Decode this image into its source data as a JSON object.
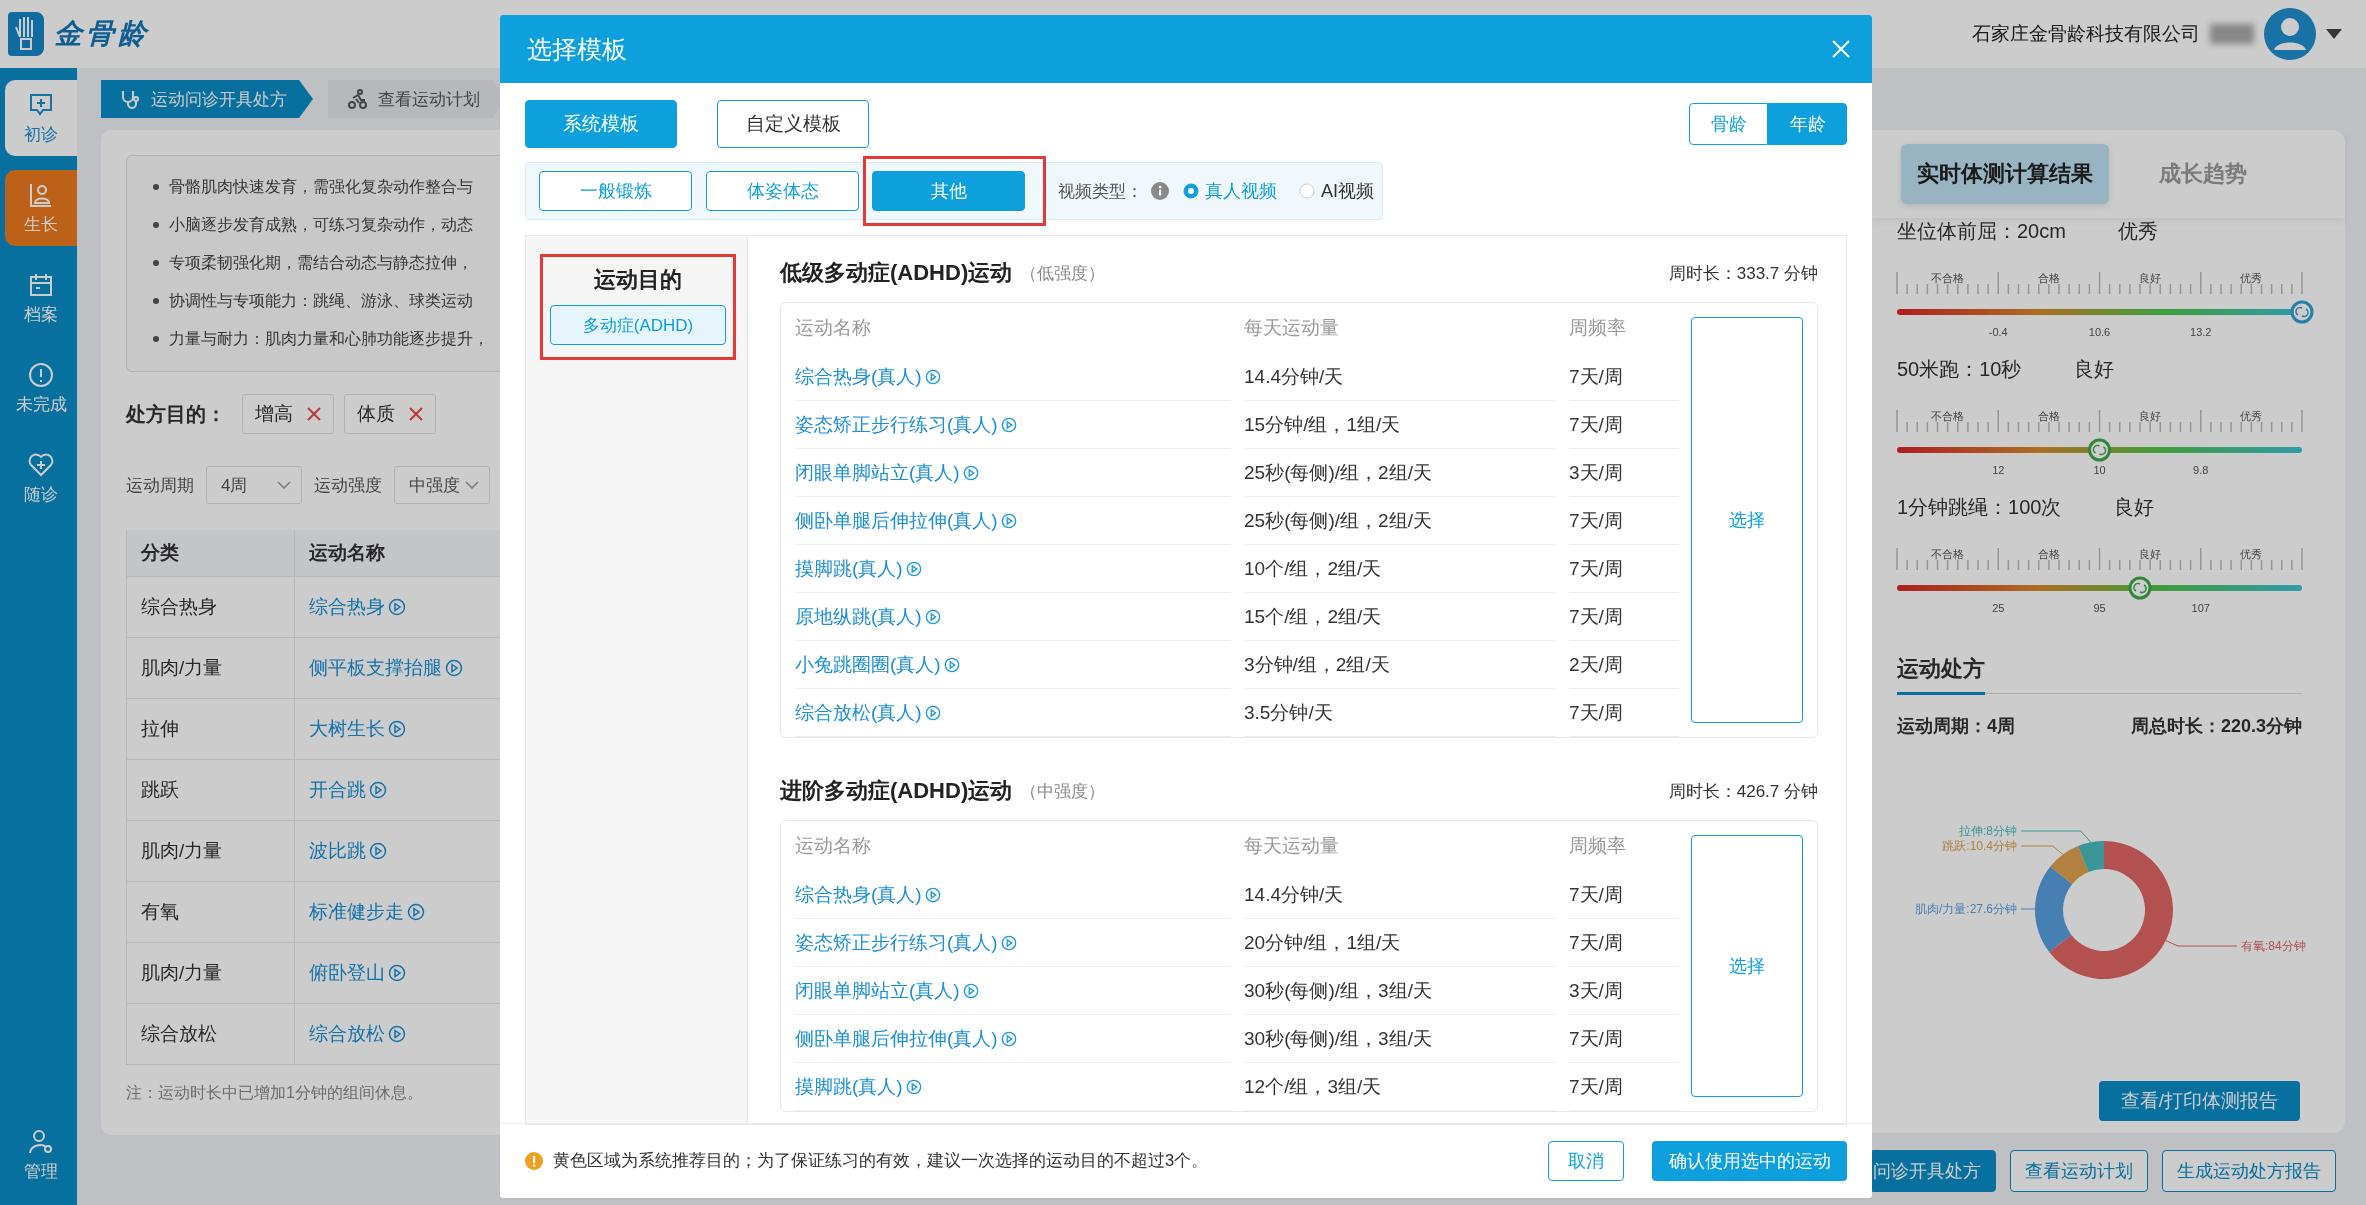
{
  "header": {
    "logo_text": "金骨龄",
    "company": "石家庄金骨龄科技有限公司"
  },
  "sidebar": {
    "items": [
      {
        "label": "初诊",
        "kind": "consult",
        "selected": false,
        "highlighted": true
      },
      {
        "label": "生长",
        "kind": "growth",
        "selected": true,
        "highlighted": false
      },
      {
        "label": "档案",
        "kind": "archive",
        "selected": false,
        "highlighted": false
      },
      {
        "label": "未完成",
        "kind": "pending",
        "selected": false,
        "highlighted": false
      },
      {
        "label": "随诊",
        "kind": "followup",
        "selected": false,
        "highlighted": false
      },
      {
        "label": "管理",
        "kind": "admin",
        "selected": false,
        "highlighted": false
      }
    ]
  },
  "steps": [
    {
      "label": "运动问诊开具处方",
      "kind": "consult",
      "selected": true
    },
    {
      "label": "查看运动计划",
      "kind": "plan",
      "selected": false
    }
  ],
  "notes": [
    "骨骼肌肉快速发育，需强化复杂动作整合与",
    "小脑逐步发育成熟，可练习复杂动作，动态",
    "专项柔韧强化期，需结合动态与静态拉伸，",
    "协调性与专项能力：跳绳、游泳、球类运动",
    "力量与耐力：肌肉力量和心肺功能逐步提升，"
  ],
  "purpose": {
    "label": "处方目的：",
    "tags": [
      "增高",
      "体质"
    ]
  },
  "filters": [
    {
      "label": "运动周期",
      "value": "4周"
    },
    {
      "label": "运动强度",
      "value": "中强度"
    }
  ],
  "table": {
    "columns": [
      "分类",
      "运动名称"
    ],
    "rows": [
      [
        "综合热身",
        "综合热身"
      ],
      [
        "肌肉/力量",
        "侧平板支撑抬腿"
      ],
      [
        "拉伸",
        "大树生长"
      ],
      [
        "跳跃",
        "开合跳"
      ],
      [
        "肌肉/力量",
        "波比跳"
      ],
      [
        "有氧",
        "标准健步走"
      ],
      [
        "肌肉/力量",
        "俯卧登山"
      ],
      [
        "综合放松",
        "综合放松"
      ]
    ]
  },
  "footnote": "注：运动时长中已增加1分钟的组间休息。",
  "dialog": {
    "title": "选择模板",
    "source_tabs": [
      {
        "label": "系统模板",
        "selected": true
      },
      {
        "label": "自定义模板",
        "selected": false
      }
    ],
    "basis_toggle": [
      {
        "label": "骨龄",
        "selected": false
      },
      {
        "label": "年龄",
        "selected": true
      }
    ],
    "categories": [
      {
        "label": "一般锻炼",
        "selected": false,
        "highlighted": false
      },
      {
        "label": "体姿体态",
        "selected": false,
        "highlighted": false
      },
      {
        "label": "其他",
        "selected": true,
        "highlighted": true
      }
    ],
    "video_type": {
      "label": "视频类型：",
      "options": [
        {
          "label": "真人视频",
          "selected": true
        },
        {
          "label": "AI视频",
          "selected": false
        }
      ]
    },
    "purpose": {
      "title": "运动目的",
      "highlighted": true,
      "items": [
        {
          "label": "多动症(ADHD)",
          "selected": true
        }
      ]
    },
    "templates": [
      {
        "title": "低级多动症(ADHD)运动",
        "intensity": "（低强度）",
        "duration": "周时长：333.7 分钟",
        "select_label": "选择",
        "columns": [
          "运动名称",
          "每天运动量",
          "周频率"
        ],
        "rows": [
          [
            "综合热身(真人)",
            "14.4分钟/天",
            "7天/周"
          ],
          [
            "姿态矫正步行练习(真人)",
            "15分钟/组，1组/天",
            "7天/周"
          ],
          [
            "闭眼单脚站立(真人)",
            "25秒(每侧)/组，2组/天",
            "3天/周"
          ],
          [
            "侧卧单腿后伸拉伸(真人)",
            "25秒(每侧)/组，2组/天",
            "7天/周"
          ],
          [
            "摸脚跳(真人)",
            "10个/组，2组/天",
            "7天/周"
          ],
          [
            "原地纵跳(真人)",
            "15个/组，2组/天",
            "7天/周"
          ],
          [
            "小兔跳圈圈(真人)",
            "3分钟/组，2组/天",
            "2天/周"
          ],
          [
            "综合放松(真人)",
            "3.5分钟/天",
            "7天/周"
          ]
        ]
      },
      {
        "title": "进阶多动症(ADHD)运动",
        "intensity": "（中强度）",
        "duration": "周时长：426.7 分钟",
        "select_label": "选择",
        "columns": [
          "运动名称",
          "每天运动量",
          "周频率"
        ],
        "rows": [
          [
            "综合热身(真人)",
            "14.4分钟/天",
            "7天/周"
          ],
          [
            "姿态矫正步行练习(真人)",
            "20分钟/组，1组/天",
            "7天/周"
          ],
          [
            "闭眼单脚站立(真人)",
            "30秒(每侧)/组，3组/天",
            "3天/周"
          ],
          [
            "侧卧单腿后伸拉伸(真人)",
            "30秒(每侧)/组，3组/天",
            "7天/周"
          ],
          [
            "摸脚跳(真人)",
            "12个/组，3组/天",
            "7天/周"
          ]
        ]
      }
    ],
    "tip": "黄色区域为系统推荐目的；为了保证练习的有效，建议一次选择的运动目的不超过3个。",
    "cancel": "取消",
    "confirm": "确认使用选中的运动"
  },
  "right_panel": {
    "tabs": [
      {
        "label": "实时体测计算结果",
        "selected": true
      },
      {
        "label": "成长趋势",
        "selected": false
      }
    ],
    "metrics": [
      {
        "name": "坐位体前屈：20cm",
        "grade": "优秀",
        "grades": [
          "不合格",
          "合格",
          "良好",
          "优秀"
        ],
        "ticks": [
          "-0.4",
          "10.6",
          "13.2"
        ],
        "level": 1.0
      },
      {
        "name": "50米跑：10秒",
        "grade": "良好",
        "grades": [
          "不合格",
          "合格",
          "良好",
          "优秀"
        ],
        "ticks": [
          "12",
          "10",
          "9.8"
        ],
        "level": 0.5
      },
      {
        "name": "1分钟跳绳：100次",
        "grade": "良好",
        "grades": [
          "不合格",
          "合格",
          "良好",
          "优秀"
        ],
        "ticks": [
          "25",
          "95",
          "107"
        ],
        "level": 0.6
      }
    ],
    "prescription": {
      "title": "运动处方",
      "period": "运动周期：4周",
      "total": "周总时长：220.3分钟",
      "chart_data": {
        "type": "donut",
        "categories": [
          "有氧",
          "肌肉/力量",
          "跳跃",
          "拉伸"
        ],
        "values": [
          84,
          27.6,
          10.4,
          8
        ],
        "value_labels": [
          ":84分钟",
          ":27.6分钟",
          ":10.4分钟",
          ":8分钟"
        ]
      }
    },
    "report_button": "查看/打印体测报告"
  },
  "bottom_buttons": [
    {
      "label": "问诊开具处方",
      "primary": true
    },
    {
      "label": "查看运动计划",
      "primary": false
    },
    {
      "label": "生成运动处方报告",
      "primary": false
    }
  ]
}
